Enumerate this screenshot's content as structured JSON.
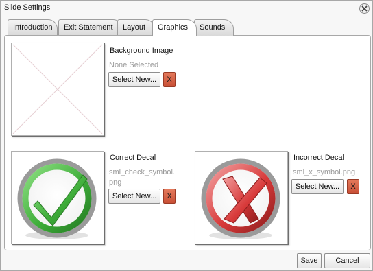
{
  "dialog": {
    "title": "Slide Settings",
    "close_icon": "close-icon"
  },
  "tabs": [
    {
      "label": "Introduction"
    },
    {
      "label": "Exit Statement"
    },
    {
      "label": "Layout"
    },
    {
      "label": "Graphics"
    },
    {
      "label": "Sounds"
    }
  ],
  "active_tab": "Graphics",
  "background_image": {
    "label": "Background Image",
    "value": "None Selected",
    "select_label": "Select New...",
    "remove_label": "X"
  },
  "correct_decal": {
    "label": "Correct Decal",
    "value_line1": "sml_check_symbol.",
    "value_line2": "png",
    "select_label": "Select New...",
    "remove_label": "X",
    "icon": "check-symbol-icon"
  },
  "incorrect_decal": {
    "label": "Incorrect Decal",
    "value": "sml_x_symbol.png",
    "select_label": "Select New...",
    "remove_label": "X",
    "icon": "x-symbol-icon"
  },
  "footer": {
    "save_label": "Save",
    "cancel_label": "Cancel"
  },
  "colors": {
    "remove_button": "#d5603f",
    "check_green": "#3fae3a",
    "x_red": "#d83a3a"
  }
}
